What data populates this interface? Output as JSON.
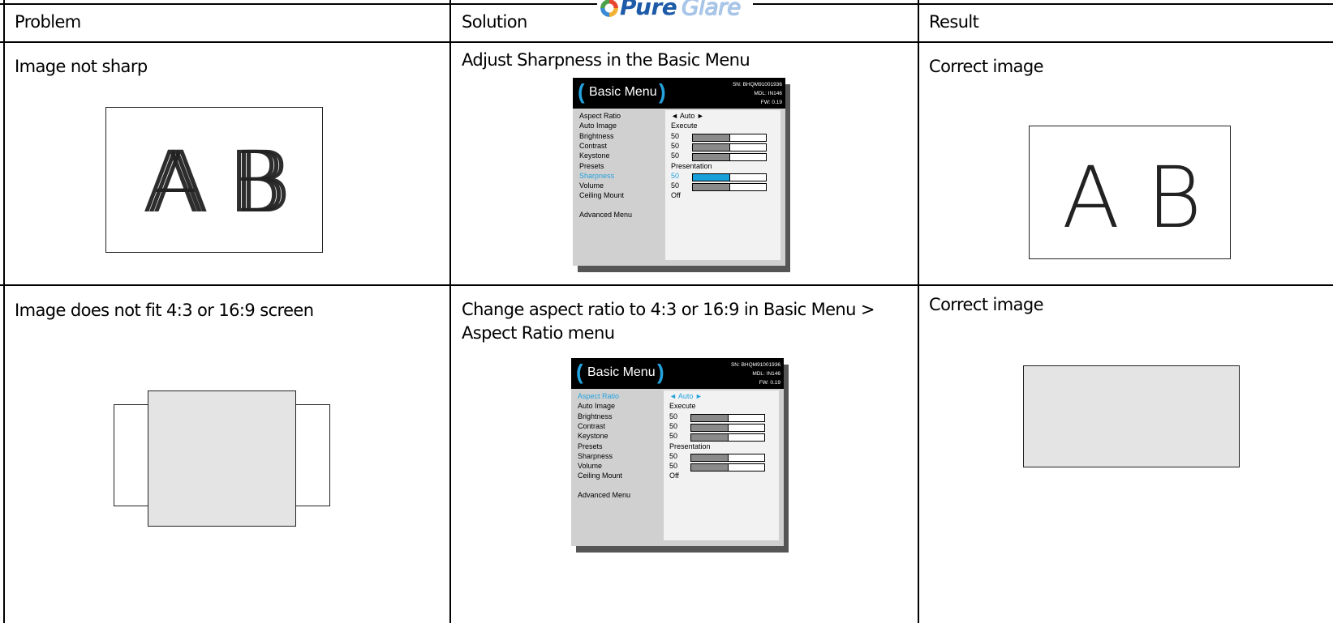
{
  "logo": {
    "text_pure": "Pure",
    "text_glare": "Glare"
  },
  "headers": {
    "problem": "Problem",
    "solution": "Solution",
    "result": "Result"
  },
  "rows": [
    {
      "problem": "Image not sharp",
      "illustration_letters": "A B",
      "solution": "Adjust Sharpness in the Basic Menu",
      "result": "Correct image",
      "result_letters": "A B",
      "menu": {
        "title": "Basic Menu",
        "sn": "SN: BHQM91001936",
        "mdl": "MDL: IN146",
        "fw": "FW: 0.19",
        "items": [
          {
            "label": "Aspect Ratio",
            "value": "◄ Auto ►",
            "bar": null,
            "highlight": false
          },
          {
            "label": "Auto Image",
            "value": "Execute",
            "bar": null,
            "highlight": false
          },
          {
            "label": "Brightness",
            "value": "50",
            "bar": 0.5,
            "highlight": false
          },
          {
            "label": "Contrast",
            "value": "50",
            "bar": 0.5,
            "highlight": false
          },
          {
            "label": "Keystone",
            "value": "50",
            "bar": 0.5,
            "highlight": false
          },
          {
            "label": "Presets",
            "value": "Presentation",
            "bar": null,
            "highlight": false
          },
          {
            "label": "Sharpness",
            "value": "50",
            "bar": 0.5,
            "highlight": true
          },
          {
            "label": "Volume",
            "value": "50",
            "bar": 0.5,
            "highlight": false
          },
          {
            "label": "Ceiling Mount",
            "value": "Off",
            "bar": null,
            "highlight": false
          }
        ],
        "advanced": "Advanced Menu"
      }
    },
    {
      "problem": "Image does not fit 4:3 or 16:9 screen",
      "solution_line1": "Change aspect ratio to 4:3 or 16:9 in Basic Menu >",
      "solution_line2": "Aspect Ratio menu",
      "result": "Correct image",
      "menu": {
        "title": "Basic Menu",
        "sn": "SN: BHQM91001936",
        "mdl": "MDL: IN146",
        "fw": "FW: 0.19",
        "items": [
          {
            "label": "Aspect Ratio",
            "value": "◄ Auto ►",
            "bar": null,
            "highlight": true
          },
          {
            "label": "Auto Image",
            "value": "Execute",
            "bar": null,
            "highlight": false
          },
          {
            "label": "Brightness",
            "value": "50",
            "bar": 0.5,
            "highlight": false
          },
          {
            "label": "Contrast",
            "value": "50",
            "bar": 0.5,
            "highlight": false
          },
          {
            "label": "Keystone",
            "value": "50",
            "bar": 0.5,
            "highlight": false
          },
          {
            "label": "Presets",
            "value": "Presentation",
            "bar": null,
            "highlight": false
          },
          {
            "label": "Sharpness",
            "value": "50",
            "bar": 0.5,
            "highlight": false
          },
          {
            "label": "Volume",
            "value": "50",
            "bar": 0.5,
            "highlight": false
          },
          {
            "label": "Ceiling Mount",
            "value": "Off",
            "bar": null,
            "highlight": false
          }
        ],
        "advanced": "Advanced Menu"
      }
    }
  ],
  "colors": {
    "highlight": "#25a3dd",
    "bar_fill": "#8a8a8a",
    "highlight_fill": "#169fd8",
    "screen_fill": "#e4e4e4"
  }
}
